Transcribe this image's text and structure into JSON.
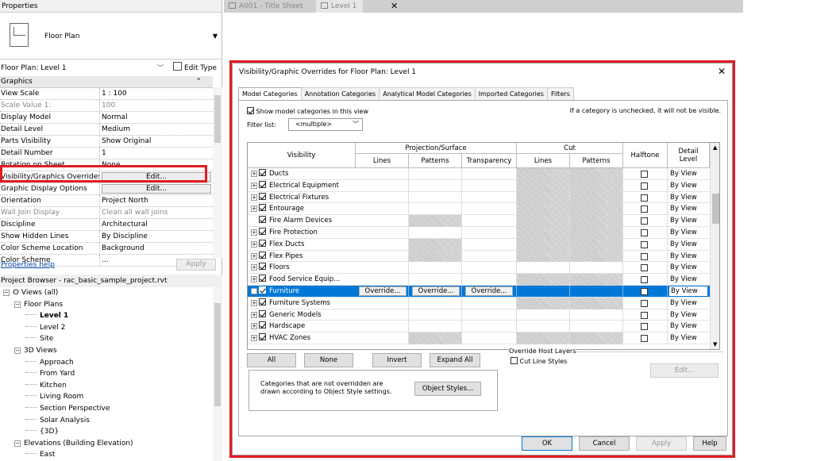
{
  "properties": {
    "header": "Properties",
    "type_name": "Floor Plan",
    "instance_label": "Floor Plan: Level 1",
    "edit_type": "Edit Type",
    "help": "Properties help",
    "apply": "Apply",
    "rows": [
      {
        "k": "Graphics",
        "g": true
      },
      {
        "k": "View Scale",
        "v": "1 : 100"
      },
      {
        "k": "Scale Value",
        "k2": "1:",
        "v": "100",
        "grey": true
      },
      {
        "k": "Display Model",
        "v": "Normal"
      },
      {
        "k": "Detail Level",
        "v": "Medium"
      },
      {
        "k": "Parts Visibility",
        "v": "Show Original"
      },
      {
        "k": "Detail Number",
        "v": "1"
      },
      {
        "k": "Rotation on Sheet",
        "v": "None"
      },
      {
        "k": "Visibility/Graphics Overrides",
        "btn": "Edit..."
      },
      {
        "k": "Graphic Display Options",
        "btn": "Edit..."
      },
      {
        "k": "Orientation",
        "v": "Project North"
      },
      {
        "k": "Wall Join Display",
        "v": "Clean all wall joins",
        "grey": true
      },
      {
        "k": "Discipline",
        "v": "Architectural"
      },
      {
        "k": "Show Hidden Lines",
        "v": "By Discipline"
      },
      {
        "k": "Color Scheme Location",
        "v": "Background"
      },
      {
        "k": "Color Scheme",
        "v": "..."
      }
    ]
  },
  "browser": {
    "header": "Project Browser - rac_basic_sample_project.rvt",
    "nodes": [
      {
        "t": "Views (all)",
        "d": 0,
        "e": "−",
        "icon": true
      },
      {
        "t": "Floor Plans",
        "d": 1,
        "e": "−"
      },
      {
        "t": "Level 1",
        "d": 2,
        "b": true
      },
      {
        "t": "Level 2",
        "d": 2
      },
      {
        "t": "Site",
        "d": 2
      },
      {
        "t": "3D Views",
        "d": 1,
        "e": "−"
      },
      {
        "t": "Approach",
        "d": 2
      },
      {
        "t": "From Yard",
        "d": 2
      },
      {
        "t": "Kitchen",
        "d": 2
      },
      {
        "t": "Living Room",
        "d": 2
      },
      {
        "t": "Section Perspective",
        "d": 2
      },
      {
        "t": "Solar Analysis",
        "d": 2
      },
      {
        "t": "{3D}",
        "d": 2
      },
      {
        "t": "Elevations (Building Elevation)",
        "d": 1,
        "e": "−"
      },
      {
        "t": "East",
        "d": 2
      }
    ]
  },
  "tabs": {
    "t1": "A001 - Title Sheet",
    "t2": "Level 1",
    "close": "✕"
  },
  "dialog": {
    "title": "Visibility/Graphic Overrides for Floor Plan: Level 1",
    "close": "✕",
    "tabs": [
      "Model Categories",
      "Annotation Categories",
      "Analytical Model Categories",
      "Imported Categories",
      "Filters"
    ],
    "show_label": "Show model categories in this view",
    "hint": "If a category is unchecked, it will not be visible.",
    "filter_label": "Filter list:",
    "filter_value": "<multiple>",
    "headers": {
      "visibility": "Visibility",
      "proj": "Projection/Surface",
      "cut": "Cut",
      "halftone": "Halftone",
      "detail": "Detail Level",
      "lines": "Lines",
      "patterns": "Patterns",
      "transparency": "Transparency",
      "clines": "Lines",
      "cpatterns": "Patterns"
    },
    "rows": [
      {
        "n": "Ducts",
        "h1": false,
        "h2": true
      },
      {
        "n": "Electrical Equipment",
        "h1": false,
        "h2": true
      },
      {
        "n": "Electrical Fixtures",
        "h1": false,
        "h2": true
      },
      {
        "n": "Entourage",
        "h1": false,
        "h2": true
      },
      {
        "n": "Fire Alarm Devices",
        "h1": true,
        "h2": true,
        "noexp": true
      },
      {
        "n": "Fire Protection",
        "h1": false,
        "h2": true
      },
      {
        "n": "Flex Ducts",
        "h1": true,
        "h2": true
      },
      {
        "n": "Flex Pipes",
        "h1": true,
        "h2": true
      },
      {
        "n": "Floors",
        "h1": false,
        "h2": false
      },
      {
        "n": "Food Service Equip...",
        "h1": false,
        "h2": true
      },
      {
        "n": "Furniture",
        "sel": true
      },
      {
        "n": "Furniture Systems",
        "h1": false,
        "h2": true
      },
      {
        "n": "Generic Models",
        "h1": false,
        "h2": false
      },
      {
        "n": "Hardscape",
        "h1": false,
        "h2": false
      },
      {
        "n": "HVAC Zones",
        "h1": true,
        "h2": true
      }
    ],
    "detail_value": "By View",
    "override": "Override...",
    "btn_all": "All",
    "btn_none": "None",
    "btn_invert": "Invert",
    "btn_expand": "Expand All",
    "ohl_title": "Override Host Layers",
    "ohl_cut": "Cut Line Styles",
    "ohl_edit": "Edit...",
    "obj_text": "Categories that are not overridden are drawn according to Object Style settings.",
    "obj_btn": "Object Styles...",
    "ok": "OK",
    "cancel": "Cancel",
    "apply": "Apply",
    "help": "Help"
  }
}
